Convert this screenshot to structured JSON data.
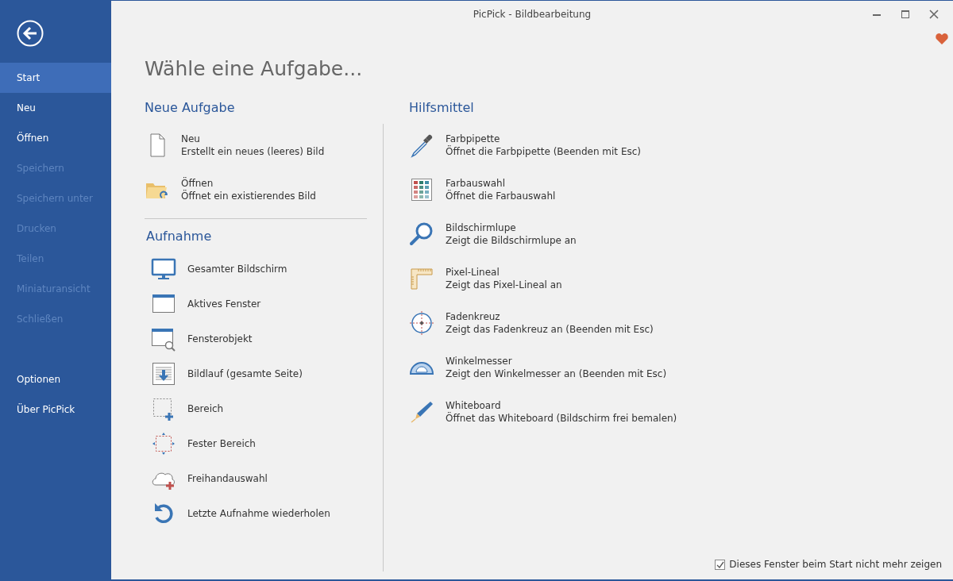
{
  "window": {
    "title": "PicPick - Bildbearbeitung"
  },
  "sidebar": {
    "items": [
      {
        "label": "Start",
        "selected": true,
        "disabled": false
      },
      {
        "label": "Neu",
        "selected": false,
        "disabled": false
      },
      {
        "label": "Öffnen",
        "selected": false,
        "disabled": false
      },
      {
        "label": "Speichern",
        "selected": false,
        "disabled": true
      },
      {
        "label": "Speichern unter",
        "selected": false,
        "disabled": true
      },
      {
        "label": "Drucken",
        "selected": false,
        "disabled": true
      },
      {
        "label": "Teilen",
        "selected": false,
        "disabled": true
      },
      {
        "label": "Miniaturansicht",
        "selected": false,
        "disabled": true
      },
      {
        "label": "Schließen",
        "selected": false,
        "disabled": true
      }
    ],
    "bottom_items": [
      {
        "label": "Optionen",
        "selected": false,
        "disabled": false
      },
      {
        "label": "Über PicPick",
        "selected": false,
        "disabled": false
      }
    ]
  },
  "heading": "Wähle eine Aufgabe...",
  "new_task": {
    "title": "Neue Aufgabe",
    "items": [
      {
        "title": "Neu",
        "description": "Erstellt ein neues (leeres) Bild"
      },
      {
        "title": "Öffnen",
        "description": "Öffnet ein existierendes Bild"
      }
    ]
  },
  "capture": {
    "title": "Aufnahme",
    "items": [
      {
        "label": "Gesamter Bildschirm"
      },
      {
        "label": "Aktives Fenster"
      },
      {
        "label": "Fensterobjekt"
      },
      {
        "label": "Bildlauf (gesamte Seite)"
      },
      {
        "label": "Bereich"
      },
      {
        "label": "Fester Bereich"
      },
      {
        "label": "Freihandauswahl"
      },
      {
        "label": "Letzte Aufnahme wiederholen"
      }
    ]
  },
  "tools": {
    "title": "Hilfsmittel",
    "items": [
      {
        "title": "Farbpipette",
        "description": "Öffnet die Farbpipette (Beenden mit Esc)"
      },
      {
        "title": "Farbauswahl",
        "description": "Öffnet die Farbauswahl"
      },
      {
        "title": "Bildschirmlupe",
        "description": "Zeigt die Bildschirmlupe an"
      },
      {
        "title": "Pixel-Lineal",
        "description": "Zeigt das Pixel-Lineal an"
      },
      {
        "title": "Fadenkreuz",
        "description": "Zeigt das Fadenkreuz an (Beenden mit Esc)"
      },
      {
        "title": "Winkelmesser",
        "description": "Zeigt den Winkelmesser an (Beenden mit Esc)"
      },
      {
        "title": "Whiteboard",
        "description": "Öffnet das Whiteboard (Bildschirm frei bemalen)"
      }
    ]
  },
  "footer": {
    "label": "Dieses Fenster beim Start nicht mehr zeigen",
    "checked": true
  }
}
